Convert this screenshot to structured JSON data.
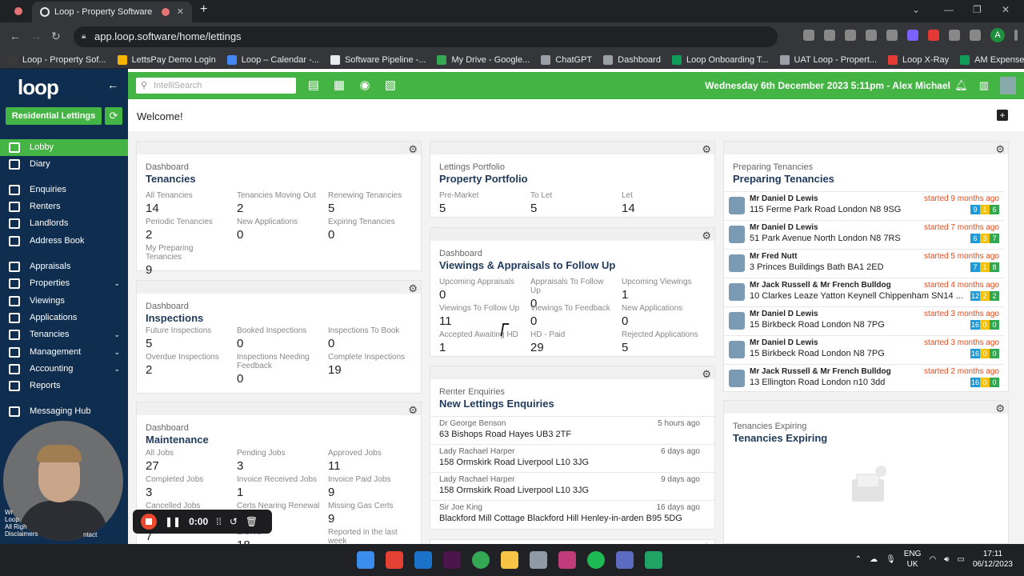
{
  "browser": {
    "tab_title": "Loop - Property Software",
    "new_tab": "+",
    "url": "app.loop.software/home/lettings",
    "bookmarks": [
      {
        "label": "Loop - Property Sof...",
        "color": "#3a3a3a"
      },
      {
        "label": "LettsPay Demo Login",
        "color": "#f4b400"
      },
      {
        "label": "Loop – Calendar -...",
        "color": "#4285f4"
      },
      {
        "label": "Software Pipeline -...",
        "color": "#e8eaed"
      },
      {
        "label": "My Drive - Google...",
        "color": "#34a853"
      },
      {
        "label": "ChatGPT",
        "color": "#9aa0a6"
      },
      {
        "label": "Dashboard",
        "color": "#9aa0a6"
      },
      {
        "label": "Loop Onboarding T...",
        "color": "#0f9d58"
      },
      {
        "label": "UAT Loop - Propert...",
        "color": "#9aa0a6"
      },
      {
        "label": "Loop X-Ray",
        "color": "#e53935"
      },
      {
        "label": "AM Expenses - Loo...",
        "color": "#0f9d58"
      }
    ]
  },
  "header": {
    "search_placeholder": "IntelliSearch",
    "datetime_user": "Wednesday 6th December 2023 5:11pm - Alex Michael",
    "accent": "#44b544"
  },
  "sidebar": {
    "logo": "loop",
    "mode_button": "Residential Lettings",
    "items": [
      {
        "label": "Lobby",
        "active": true,
        "chevron": false
      },
      {
        "label": "Diary",
        "active": false,
        "chevron": false
      },
      {
        "label": "Enquiries",
        "active": false,
        "chevron": false
      },
      {
        "label": "Renters",
        "active": false,
        "chevron": false
      },
      {
        "label": "Landlords",
        "active": false,
        "chevron": false
      },
      {
        "label": "Address Book",
        "active": false,
        "chevron": false
      },
      {
        "label": "Appraisals",
        "active": false,
        "chevron": false
      },
      {
        "label": "Properties",
        "active": false,
        "chevron": true
      },
      {
        "label": "Viewings",
        "active": false,
        "chevron": false
      },
      {
        "label": "Applications",
        "active": false,
        "chevron": false
      },
      {
        "label": "Tenancies",
        "active": false,
        "chevron": true
      },
      {
        "label": "Management",
        "active": false,
        "chevron": true
      },
      {
        "label": "Accounting",
        "active": false,
        "chevron": true
      },
      {
        "label": "Reports",
        "active": false,
        "chevron": false
      },
      {
        "label": "Messaging Hub",
        "active": false,
        "chevron": false
      }
    ],
    "footer_lines": [
      "Wr",
      "Loop",
      "All Righ",
      "Disclaimers"
    ],
    "footer_contact": "ntact"
  },
  "recorder": {
    "time": "0:00"
  },
  "main": {
    "welcome": "Welcome!",
    "tenancies": {
      "category": "Dashboard",
      "title": "Tenancies",
      "stats": [
        {
          "label": "All Tenancies",
          "value": "14"
        },
        {
          "label": "Tenancies Moving Out",
          "value": "2"
        },
        {
          "label": "Renewing Tenancies",
          "value": "5"
        },
        {
          "label": "Periodic Tenancies",
          "value": "2"
        },
        {
          "label": "New Applications",
          "value": "0"
        },
        {
          "label": "Expiring Tenancies",
          "value": "0"
        },
        {
          "label": "My Preparing Tenancies",
          "value": "9"
        }
      ]
    },
    "inspections": {
      "category": "Dashboard",
      "title": "Inspections",
      "stats": [
        {
          "label": "Future Inspections",
          "value": "5"
        },
        {
          "label": "Booked Inspections",
          "value": "0"
        },
        {
          "label": "Inspections To Book",
          "value": "0"
        },
        {
          "label": "Overdue Inspections",
          "value": "2"
        },
        {
          "label": "Inspections Needing Feedback",
          "value": "0"
        },
        {
          "label": "Complete Inspections",
          "value": "19"
        }
      ]
    },
    "maintenance": {
      "category": "Dashboard",
      "title": "Maintenance",
      "stats": [
        {
          "label": "All Jobs",
          "value": "27"
        },
        {
          "label": "Pending Jobs",
          "value": "3"
        },
        {
          "label": "Approved Jobs",
          "value": "11"
        },
        {
          "label": "Completed Jobs",
          "value": "3"
        },
        {
          "label": "Invoice Received Jobs",
          "value": "1"
        },
        {
          "label": "Invoice Paid Jobs",
          "value": "9"
        },
        {
          "label": "Cancelled Jobs",
          "value": ""
        },
        {
          "label": "Certs Nearing Renewal",
          "value": ""
        },
        {
          "label": "Missing Gas Certs",
          "value": "9"
        },
        {
          "label": "",
          "value": "7"
        },
        {
          "label": "EICR's",
          "value": "18"
        },
        {
          "label": "Reported in the last week",
          "value": ""
        }
      ]
    },
    "portfolio": {
      "category": "Lettings Portfolio",
      "title": "Property Portfolio",
      "stats": [
        {
          "label": "Pre-Market",
          "value": "5"
        },
        {
          "label": "To Let",
          "value": "5"
        },
        {
          "label": "Let",
          "value": "14"
        }
      ]
    },
    "viewings": {
      "category": "Dashboard",
      "title": "Viewings & Appraisals to Follow Up",
      "stats": [
        {
          "label": "Upcoming Appraisals",
          "value": "0"
        },
        {
          "label": "Appraisals To Follow Up",
          "value": "0"
        },
        {
          "label": "Upcoming Viewings",
          "value": "1"
        },
        {
          "label": "Viewings To Follow Up",
          "value": "11"
        },
        {
          "label": "Viewings To Feedback",
          "value": "0"
        },
        {
          "label": "New Applications",
          "value": "0"
        },
        {
          "label": "Accepted Awaiting HD",
          "value": "1"
        },
        {
          "label": "HD - Paid",
          "value": "29"
        },
        {
          "label": "Rejected Applications",
          "value": "5"
        }
      ]
    },
    "enquiries": {
      "category": "Renter Enquiries",
      "title": "New Lettings Enquiries",
      "rows": [
        {
          "name": "Dr George Benson",
          "address": "63 Bishops Road Hayes UB3 2TF",
          "when": "5 hours ago"
        },
        {
          "name": "Lady Rachael Harper",
          "address": "158 Ormskirk Road Liverpool L10 3JG",
          "when": "6 days ago"
        },
        {
          "name": "Lady Rachael Harper",
          "address": "158 Ormskirk Road Liverpool L10 3JG",
          "when": "9 days ago"
        },
        {
          "name": "Sir Joe King",
          "address": "Blackford Mill Cottage Blackford Hill Henley-in-arden B95 5DG",
          "when": "16 days ago"
        }
      ]
    },
    "preparing": {
      "category": "Preparing Tenancies",
      "title": "Preparing Tenancies",
      "rows": [
        {
          "name": "Mr Daniel D Lewis",
          "address": "115 Ferme Park Road London N8 9SG",
          "when": "started 9 months ago",
          "badges": [
            "9",
            "1",
            "6"
          ]
        },
        {
          "name": "Mr Daniel D Lewis",
          "address": "51 Park Avenue North London N8 7RS",
          "when": "started 7 months ago",
          "badges": [
            "6",
            "3",
            "7"
          ]
        },
        {
          "name": "Mr Fred Nutt",
          "address": "3 Princes Buildings Bath BA1 2ED",
          "when": "started 5 months ago",
          "badges": [
            "7",
            "1",
            "8"
          ]
        },
        {
          "name": "Mr Jack Russell & Mr French Bulldog",
          "address": "10 Clarkes Leaze Yatton Keynell Chippenham SN14 ...",
          "when": "started 4 months ago",
          "badges": [
            "12",
            "2",
            "2"
          ]
        },
        {
          "name": "Mr Daniel D Lewis",
          "address": "15 Birkbeck Road London N8 7PG",
          "when": "started 3 months ago",
          "badges": [
            "16",
            "0",
            "0"
          ]
        },
        {
          "name": "Mr Daniel D Lewis",
          "address": "15 Birkbeck Road London N8 7PG",
          "when": "started 3 months ago",
          "badges": [
            "16",
            "0",
            "0"
          ]
        },
        {
          "name": "Mr Jack Russell & Mr French Bulldog",
          "address": "13 Ellington Road London n10 3dd",
          "when": "started 2 months ago",
          "badges": [
            "16",
            "0",
            "0"
          ]
        }
      ],
      "badge_colors": [
        "#1e9bd7",
        "#f4c20d",
        "#2fa84f"
      ]
    },
    "expiring": {
      "category": "Tenancies Expiring",
      "title": "Tenancies Expiring"
    }
  },
  "taskbar": {
    "lang": "ENG",
    "region": "UK",
    "time": "17:11",
    "date": "06/12/2023"
  }
}
